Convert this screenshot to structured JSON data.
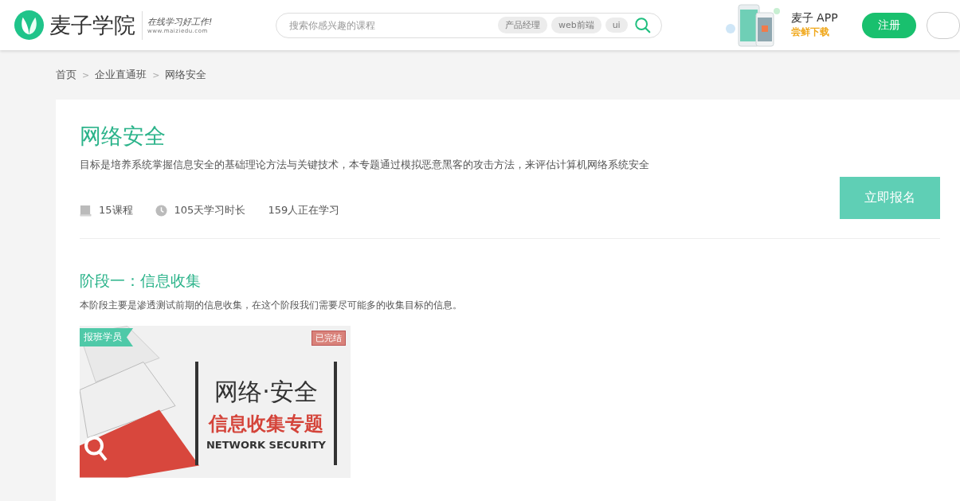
{
  "header": {
    "logo_text": "麦子学院",
    "slogan": "在线学习好工作!",
    "site_url": "www.maiziedu.com",
    "search": {
      "placeholder": "搜索你感兴趣的课程",
      "tags": [
        "产品经理",
        "web前端",
        "ui"
      ]
    },
    "app_promo": {
      "title": "麦子 APP",
      "subtitle": "尝鲜下载"
    },
    "register_button": "注册"
  },
  "breadcrumb": [
    {
      "label": "首页"
    },
    {
      "label": "企业直通班"
    },
    {
      "label": "网络安全"
    }
  ],
  "breadcrumb_separator": ">",
  "course": {
    "title": "网络安全",
    "description": "目标是培养系统掌握信息安全的基础理论方法与关键技术，本专题通过模拟恶意黑客的攻击方法，来评估计算机网络系统安全",
    "stats": [
      {
        "kind": "book",
        "text": "15课程"
      },
      {
        "kind": "clock",
        "text": "105天学习时长"
      },
      {
        "kind": "none",
        "text": "159人正在学习"
      }
    ],
    "enroll_button": "立即报名"
  },
  "stages": [
    {
      "title": "阶段一：信息收集",
      "description": "本阶段主要是渗透测试前期的信息收集，在这个阶段我们需要尽可能多的收集目标的信息。",
      "cover": {
        "badge": "报班学员",
        "status": "已完结",
        "heading": "网络·安全",
        "subheading": "信息收集专题",
        "english": "NETWORK SECURITY"
      }
    }
  ]
}
